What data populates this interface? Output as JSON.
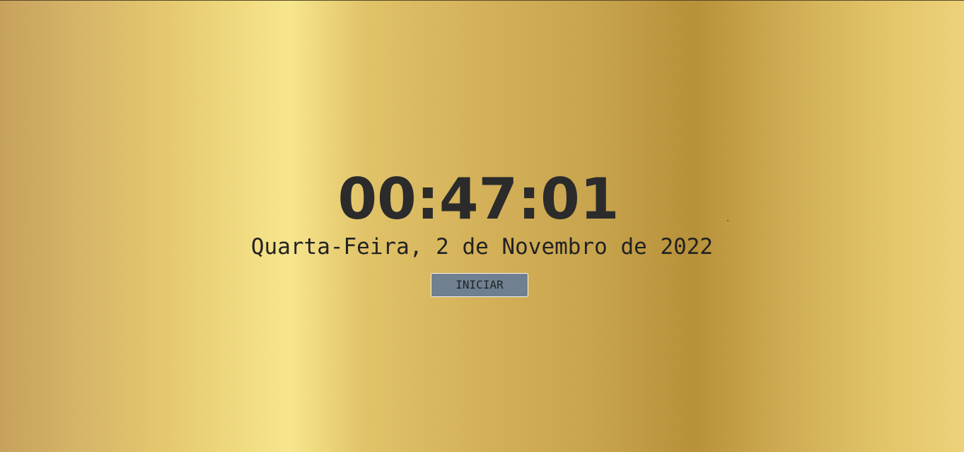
{
  "clock": {
    "time": "00:47:01",
    "date": "Quarta-Feira, 2 de Novembro de 2022"
  },
  "controls": {
    "start_label": "INICIAR"
  },
  "stray_mark": "`",
  "colors": {
    "text": "#2b2b2b",
    "button_bg": "#708090",
    "button_border": "#f4f4f4",
    "background": "brushed-gold"
  }
}
